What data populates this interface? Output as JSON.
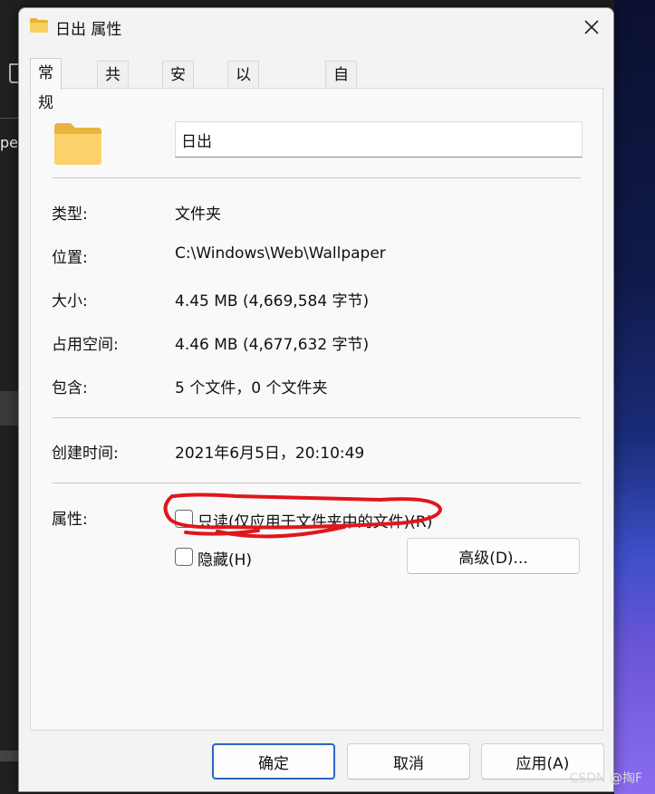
{
  "window": {
    "title": "日出 属性"
  },
  "tabs": [
    {
      "label": "常规",
      "active": true
    },
    {
      "label": "共享",
      "active": false
    },
    {
      "label": "安全",
      "active": false
    },
    {
      "label": "以前的版本",
      "active": false
    },
    {
      "label": "自定义",
      "active": false
    }
  ],
  "general": {
    "folder_name": "日出",
    "type_label": "类型:",
    "type_value": "文件夹",
    "location_label": "位置:",
    "location_value": "C:\\Windows\\Web\\Wallpaper",
    "size_label": "大小:",
    "size_value": "4.45 MB (4,669,584 字节)",
    "size_on_disk_label": "占用空间:",
    "size_on_disk_value": "4.46 MB (4,677,632 字节)",
    "contains_label": "包含:",
    "contains_value": "5 个文件，0 个文件夹",
    "created_label": "创建时间:",
    "created_value": "2021年6月5日，20:10:49",
    "attributes_label": "属性:",
    "readonly_label": "只读(仅应用于文件夹中的文件)(R)",
    "readonly_checked": false,
    "hidden_label": "隐藏(H)",
    "hidden_checked": false,
    "advanced_button": "高级(D)..."
  },
  "footer": {
    "ok": "确定",
    "cancel": "取消",
    "apply": "应用(A)"
  },
  "watermark": "CSDN @掏F",
  "colors": {
    "annotation": "#e0161c",
    "primary_border": "#2a66c4",
    "folder": "#f6c85a"
  },
  "icons": {
    "title": "folder-icon",
    "close": "close-icon",
    "big": "folder-icon"
  }
}
